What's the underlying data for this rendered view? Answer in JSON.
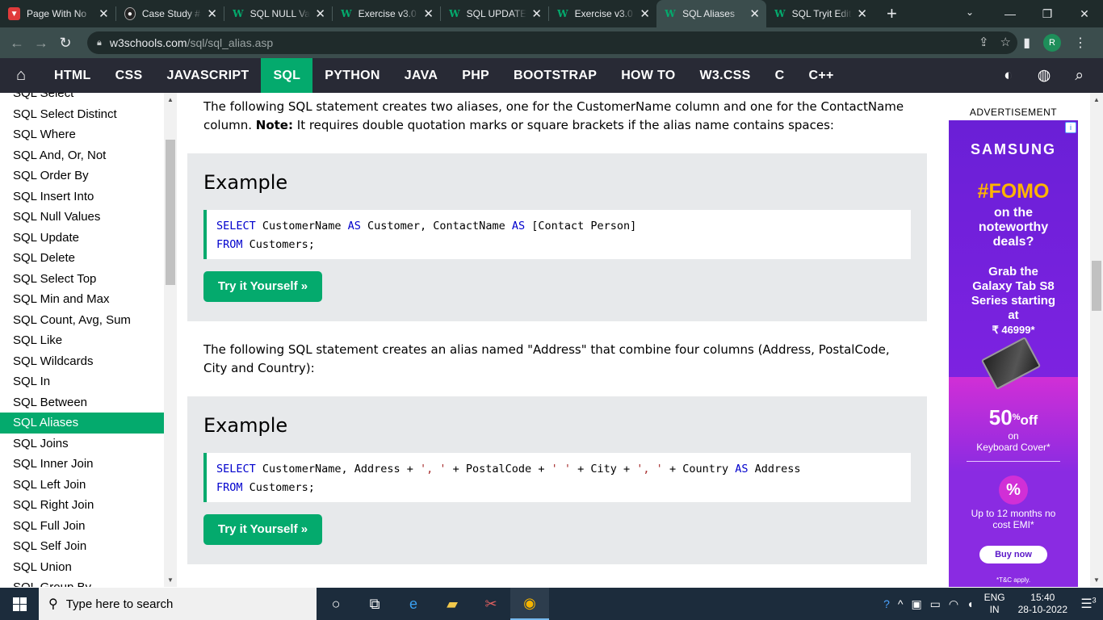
{
  "browser": {
    "tabs": [
      {
        "title": "Page With No",
        "favicon": "red"
      },
      {
        "title": "Case Study #",
        "favicon": "dark"
      },
      {
        "title": "SQL NULL Val",
        "favicon": "w3"
      },
      {
        "title": "Exercise v3.0",
        "favicon": "w3"
      },
      {
        "title": "SQL UPDATE",
        "favicon": "w3"
      },
      {
        "title": "Exercise v3.0",
        "favicon": "w3"
      },
      {
        "title": "SQL Aliases",
        "favicon": "w3"
      },
      {
        "title": "SQL Tryit Edit",
        "favicon": "w3"
      }
    ],
    "active_tab_index": 6,
    "url_host": "w3schools.com",
    "url_path": "/sql/sql_alias.asp",
    "profile_initial": "R"
  },
  "topnav": {
    "items": [
      "HTML",
      "CSS",
      "JAVASCRIPT",
      "SQL",
      "PYTHON",
      "JAVA",
      "PHP",
      "BOOTSTRAP",
      "HOW TO",
      "W3.CSS",
      "C",
      "C++"
    ],
    "active": "SQL"
  },
  "sidebar": {
    "items": [
      "SQL Select",
      "SQL Select Distinct",
      "SQL Where",
      "SQL And, Or, Not",
      "SQL Order By",
      "SQL Insert Into",
      "SQL Null Values",
      "SQL Update",
      "SQL Delete",
      "SQL Select Top",
      "SQL Min and Max",
      "SQL Count, Avg, Sum",
      "SQL Like",
      "SQL Wildcards",
      "SQL In",
      "SQL Between",
      "SQL Aliases",
      "SQL Joins",
      "SQL Inner Join",
      "SQL Left Join",
      "SQL Right Join",
      "SQL Full Join",
      "SQL Self Join",
      "SQL Union",
      "SQL Group By"
    ],
    "active": "SQL Aliases"
  },
  "content": {
    "para1_a": "The following SQL statement creates two aliases, one for the CustomerName column and one for the ContactName column.",
    "para1_note": "Note:",
    "para1_b": "It requires double quotation marks or square brackets if the alias name contains spaces:",
    "example1": {
      "heading": "Example",
      "line1": {
        "kw1": "SELECT",
        "t1": "CustomerName",
        "kw2": "AS",
        "t2": "Customer, ContactName",
        "kw3": "AS",
        "t3": "[Contact Person]"
      },
      "line2": {
        "kw1": "FROM",
        "t1": "Customers;"
      },
      "button": "Try it Yourself »"
    },
    "para2": "The following SQL statement creates an alias named \"Address\" that combine four columns (Address, PostalCode, City and Country):",
    "example2": {
      "heading": "Example",
      "line1": {
        "kw1": "SELECT",
        "t1": "CustomerName, Address +",
        "s1": "', '",
        "t2": "+ PostalCode +",
        "s2": "' '",
        "t3": "+ City +",
        "s3": "', '",
        "t4": "+ Country",
        "kw2": "AS",
        "t5": "Address"
      },
      "line2": {
        "kw1": "FROM",
        "t1": "Customers;"
      },
      "button": "Try it Yourself »"
    }
  },
  "ad": {
    "label": "ADVERTISEMENT",
    "brand": "SAMSUNG",
    "headline": "#FOMO",
    "line1": "on the noteworthy deals?",
    "line2": "Grab the Galaxy Tab S8 Series starting at",
    "price": "₹ 46999*",
    "discount_main": "50",
    "discount_sup": "%",
    "discount_off": "off",
    "discount_on": "on",
    "discount_item": "Keyboard Cover*",
    "pct_icon": "%",
    "emi_line": "Up to 12 months no cost EMI*",
    "cta": "Buy now",
    "tnc": "*T&C apply."
  },
  "taskbar": {
    "search_placeholder": "Type here to search",
    "lang_top": "ENG",
    "lang_bottom": "IN",
    "time": "15:40",
    "date": "28-10-2022",
    "notifications": "3"
  },
  "colors": {
    "w3_green": "#04aa6d",
    "topnav_bg": "#282a35",
    "example_bg": "#e7e9eb",
    "code_keyword": "#0000cd",
    "code_string": "#a52a2a"
  }
}
